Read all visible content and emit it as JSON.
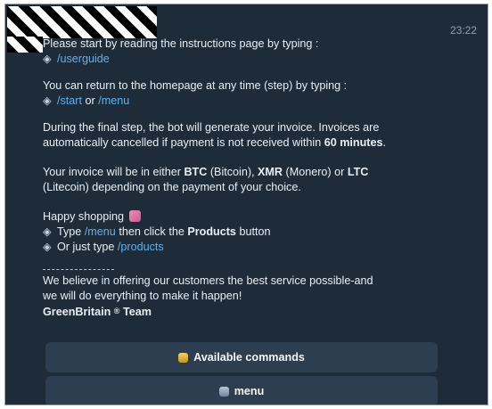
{
  "message": {
    "timestamp": "23:22",
    "p1_text": "Please start by reading the instructions page by typing :",
    "p1_cmd": "/userguide",
    "p2_text": "You can return to the homepage at any time (step) by typing :",
    "p2_cmd1": "/start",
    "p2_or": "or",
    "p2_cmd2": "/menu",
    "p3_line1": "During the final step, the bot will generate your invoice. Invoices are",
    "p3_line2_a": "automatically cancelled if payment is not received within",
    "p3_line2_bold": "60 minutes",
    "p3_line2_end": ".",
    "p4_line1_a": "Your invoice will be in either",
    "p4_btc": "BTC",
    "p4_btc_full": "(Bitcoin),",
    "p4_xmr": "XMR",
    "p4_xmr_full": "(Monero) or",
    "p4_ltc": "LTC",
    "p4_line2": "(Litecoin) depending on the payment of your choice.",
    "p5_heading": "Happy shopping",
    "p5_type": "Type",
    "p5_menu_cmd": "/menu",
    "p5_then": "then click the",
    "p5_products_bold": "Products",
    "p5_button": "button",
    "p5_or_just": "Or just type",
    "p5_products_cmd": "/products",
    "p6_line1": "We believe in offering our customers the best service possible-and",
    "p6_line2": "we will do everything to make it happen!",
    "p6_sig_a": "GreenBritain",
    "p6_sig_reg": "®",
    "p6_sig_b": "Team",
    "bullet_glyph": "◈"
  },
  "keyboard": {
    "button1_label": "Available commands",
    "button1_icon": "tray-icon",
    "button2_label": "menu",
    "button2_icon": "box-icon"
  },
  "colors": {
    "background": "#1e2c3a",
    "link": "#5eb0f0",
    "button": "#2d3e50"
  }
}
